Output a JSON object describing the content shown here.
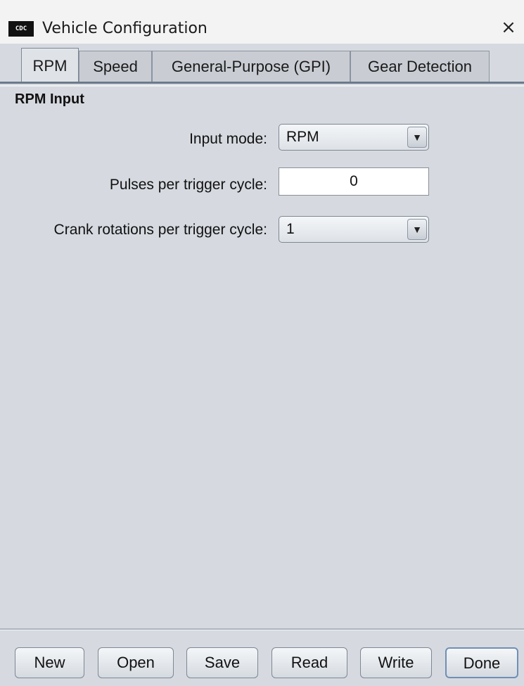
{
  "window": {
    "title": "Vehicle Configuration",
    "app_icon_text": "CDC",
    "close_glyph": "×"
  },
  "tabs": [
    {
      "label": "RPM",
      "active": true
    },
    {
      "label": "Speed",
      "active": false
    },
    {
      "label": "General-Purpose (GPI)",
      "active": false
    },
    {
      "label": "Gear Detection",
      "active": false
    }
  ],
  "rpm_input": {
    "section_title": "RPM Input",
    "input_mode_label": "Input mode:",
    "input_mode_value": "RPM",
    "pulses_label": "Pulses per trigger cycle:",
    "pulses_value": "0",
    "crank_label": "Crank rotations per trigger cycle:",
    "crank_value": "1",
    "dropdown_glyph": "▼"
  },
  "buttons": {
    "new": "New",
    "open": "Open",
    "save": "Save",
    "read": "Read",
    "write": "Write",
    "done": "Done"
  }
}
